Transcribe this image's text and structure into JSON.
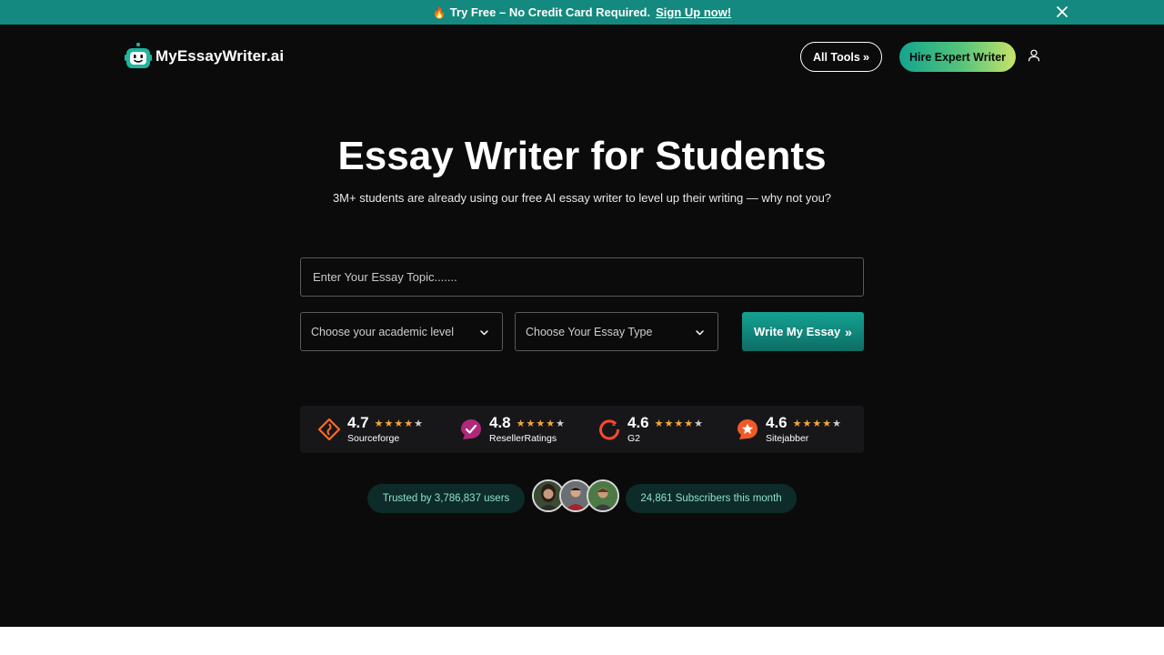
{
  "promo": {
    "text": "Try Free – No Credit Card Required.",
    "link": "Sign Up now!"
  },
  "header": {
    "logo_text": "MyEssayWriter.ai",
    "all_tools_label": "All Tools",
    "hire_label": "Hire Expert Writer"
  },
  "hero": {
    "title": "Essay Writer for Students",
    "subtitle": "3M+ students are already using our free AI essay writer to level up their writing — why not you?"
  },
  "form": {
    "topic_placeholder": "Enter Your Essay Topic.......",
    "topic_value": "",
    "level_label": "Choose your academic level",
    "type_label": "Choose Your Essay Type",
    "submit_label": "Write My Essay"
  },
  "ratings": [
    {
      "score": "4.7",
      "name": "Sourceforge",
      "icon": "sourceforge-icon"
    },
    {
      "score": "4.8",
      "name": "ResellerRatings",
      "icon": "resellerratings-icon"
    },
    {
      "score": "4.6",
      "name": "G2",
      "icon": "g2-icon"
    },
    {
      "score": "4.6",
      "name": "Sitejabber",
      "icon": "sitejabber-icon"
    }
  ],
  "trust": {
    "users": "Trusted by 3,786,837 users",
    "subscribers": "24,861 Subscribers this month"
  },
  "colors": {
    "promo_bg": "#14897f",
    "page_bg": "#0b0b0c",
    "accent": "#14a293",
    "stars": "#f4a83a",
    "pill_bg": "#0d2b28"
  }
}
